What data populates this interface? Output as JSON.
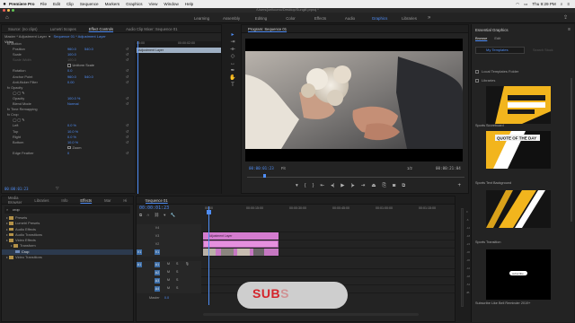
{
  "menubar": {
    "app": "Premiere Pro",
    "menus": [
      "File",
      "Edit",
      "Clip",
      "Sequence",
      "Markers",
      "Graphics",
      "View",
      "Window",
      "Help"
    ],
    "clock": "Thu 9:29 PM"
  },
  "titlebar": {
    "path": "/Users/joeltoomo/Desktop/Sungilf.prproj *"
  },
  "workspaces": {
    "tabs": [
      "Learning",
      "Assembly",
      "Editing",
      "Color",
      "Effects",
      "Audio",
      "Graphics",
      "Libraries"
    ],
    "active": "Graphics"
  },
  "effect_controls": {
    "tabs": [
      "Source: (no clips)",
      "Lumetri Scopes",
      "Effect Controls",
      "Audio Clip Mixer: Sequence 01"
    ],
    "active_tab": "Effect Controls",
    "master": "Master * Adjustment Layer",
    "master_seq": "Sequence 01 * Adjustment Layer",
    "timeline_clip": "Adjustment Layer",
    "ruler_a": "00:00",
    "ruler_b": "00:00:02:00",
    "section": "Video",
    "rows": [
      {
        "label": "fx  Motion",
        "v1": "",
        "v2": "",
        "indent": 2
      },
      {
        "label": "Position",
        "v1": "960.0",
        "v2": "540.0",
        "indent": 6
      },
      {
        "label": "Scale",
        "v1": "100.0",
        "v2": "",
        "indent": 6
      },
      {
        "label": "Scale Width",
        "v1": "100.0",
        "v2": "",
        "indent": 6,
        "dim": true
      },
      {
        "label": "",
        "v1": "Uniform Scale",
        "v2": "",
        "indent": 6,
        "check": true
      },
      {
        "label": "Rotation",
        "v1": "0.0",
        "v2": "",
        "indent": 6
      },
      {
        "label": "Anchor Point",
        "v1": "960.0",
        "v2": "540.0",
        "indent": 6
      },
      {
        "label": "Anti-flicker Filter",
        "v1": "0.00",
        "v2": "",
        "indent": 6
      },
      {
        "label": "fx  Opacity",
        "v1": "",
        "v2": "",
        "indent": 2
      },
      {
        "label": "",
        "v1": "",
        "v2": "",
        "indent": 6,
        "shapes": true
      },
      {
        "label": "Opacity",
        "v1": "100.0 %",
        "v2": "",
        "indent": 6
      },
      {
        "label": "Blend Mode",
        "v1": "Normal",
        "v2": "",
        "indent": 6
      },
      {
        "label": "fx  Time Remapping",
        "v1": "",
        "v2": "",
        "indent": 2
      },
      {
        "label": "fx  Crop",
        "v1": "",
        "v2": "",
        "indent": 2
      },
      {
        "label": "",
        "v1": "",
        "v2": "",
        "indent": 6,
        "shapes": true
      },
      {
        "label": "Left",
        "v1": "0.0 %",
        "v2": "",
        "indent": 6
      },
      {
        "label": "Top",
        "v1": "10.0 %",
        "v2": "",
        "indent": 6
      },
      {
        "label": "Right",
        "v1": "0.0 %",
        "v2": "",
        "indent": 6
      },
      {
        "label": "Bottom",
        "v1": "10.0 %",
        "v2": "",
        "indent": 6
      },
      {
        "label": "",
        "v1": "Zoom",
        "v2": "",
        "indent": 6,
        "check": true
      },
      {
        "label": "Edge Feather",
        "v1": "0",
        "v2": "",
        "indent": 6
      }
    ],
    "timecode": "00:00:01:23"
  },
  "program": {
    "title": "Program: Sequence 01",
    "timecode": "00:00:01:23",
    "fit": "Fit",
    "quality": "1/2",
    "duration": "00:00:21:04"
  },
  "essential_graphics": {
    "title": "Essential Graphics",
    "tabs": [
      "Browse",
      "Edit"
    ],
    "active_tab": "Browse",
    "dropdown": "My Templates",
    "search": "Search Stock",
    "checks": [
      "Local Templates Folder",
      "Libraries"
    ],
    "templates": [
      {
        "name": "Sports Scoreboard"
      },
      {
        "name": "Sports Text Background"
      },
      {
        "name": "Sports Transition"
      },
      {
        "name": "Subscribe Like Bell Reminder 2019+"
      }
    ],
    "thumb_text": "QUOTE OF THE DAY",
    "bell_text": "subscribe"
  },
  "effects_panel": {
    "tabs": [
      "Media Browser",
      "Libraries",
      "Info",
      "Effects",
      "Mar",
      "Hi"
    ],
    "active_tab": "Effects",
    "search": "crop",
    "tree": [
      {
        "label": "Presets",
        "type": "folder",
        "indent": 1
      },
      {
        "label": "Lumetri Presets",
        "type": "folder",
        "indent": 1
      },
      {
        "label": "Audio Effects",
        "type": "folder",
        "indent": 1
      },
      {
        "label": "Audio Transitions",
        "type": "folder",
        "indent": 1
      },
      {
        "label": "Video Effects",
        "type": "folder",
        "indent": 1
      },
      {
        "label": "Transform",
        "type": "folder",
        "indent": 2
      },
      {
        "label": "Crop",
        "type": "fx",
        "indent": 3,
        "selected": true
      },
      {
        "label": "Video Transitions",
        "type": "folder",
        "indent": 1
      }
    ]
  },
  "timeline": {
    "tab": "Sequence 01",
    "timecode": "00:00:01:23",
    "ruler": [
      "00:00",
      "00:00:15:00",
      "00:00:30:00",
      "00:00:45:00",
      "00:01:00:00",
      "00:01:15:00"
    ],
    "tracks": [
      "V4",
      "V3",
      "V2",
      "V1",
      "A1",
      "A2",
      "A3",
      "A4"
    ],
    "master": "Master",
    "master_val": "0.0",
    "adj_label": "Adjustment Layer",
    "v_source": "V1",
    "a_source": "A1"
  },
  "meter": {
    "scale": [
      "0",
      "-6",
      "-12",
      "-18",
      "-24",
      "-30",
      "-36",
      "-42",
      "-48",
      "-54",
      "dB"
    ]
  },
  "overlay": {
    "subs_text": "SUB",
    "subs_faded": "S"
  },
  "colors": {
    "accent": "#4f8df5",
    "clip_pink": "#e590de",
    "subs_red": "#d4242b"
  }
}
